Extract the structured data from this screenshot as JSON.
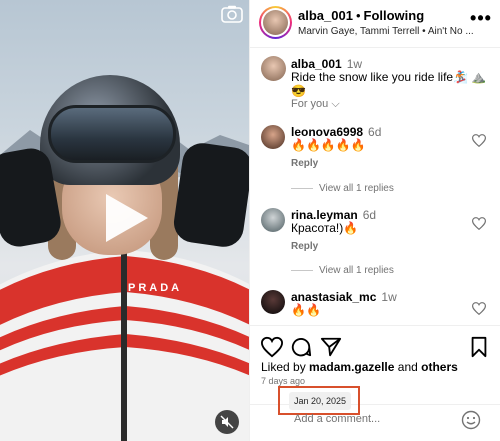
{
  "post": {
    "username": "alba_001",
    "separator": "•",
    "follow_status": "Following",
    "audio": "Marvin Gaye, Tammi Terrell • Ain't No ...",
    "caption_time": "1w",
    "caption_text": "Ride the snow like you ride life🏂 ⛰️ 😎",
    "sort_label": "For you ⌵",
    "jacket_brand": "PRADA"
  },
  "comments": [
    {
      "username": "leonova6998",
      "time": "6d",
      "text": "🔥🔥🔥🔥🔥",
      "reply_label": "Reply",
      "replies_label": "View all 1 replies"
    },
    {
      "username": "rina.leyman",
      "time": "6d",
      "text": "Красота!)🔥",
      "reply_label": "Reply",
      "replies_label": "View all 1 replies"
    },
    {
      "username": "anastasiak_mc",
      "time": "1w",
      "text": "🔥🔥"
    }
  ],
  "likes": {
    "prefix": "Liked by",
    "user": "madam.gazelle",
    "middle": "and",
    "others": "others"
  },
  "posted_ago": "7 days ago",
  "date_tooltip": "Jan 20, 2025",
  "comment_input": {
    "placeholder": "Add a comment..."
  },
  "colors": {
    "highlight_border": "#d8502c",
    "muted_text": "#737373"
  },
  "icons": [
    "camera-icon",
    "play-icon",
    "mute-icon",
    "more-icon",
    "heart-icon",
    "comment-icon",
    "share-icon",
    "bookmark-icon",
    "smile-icon"
  ]
}
